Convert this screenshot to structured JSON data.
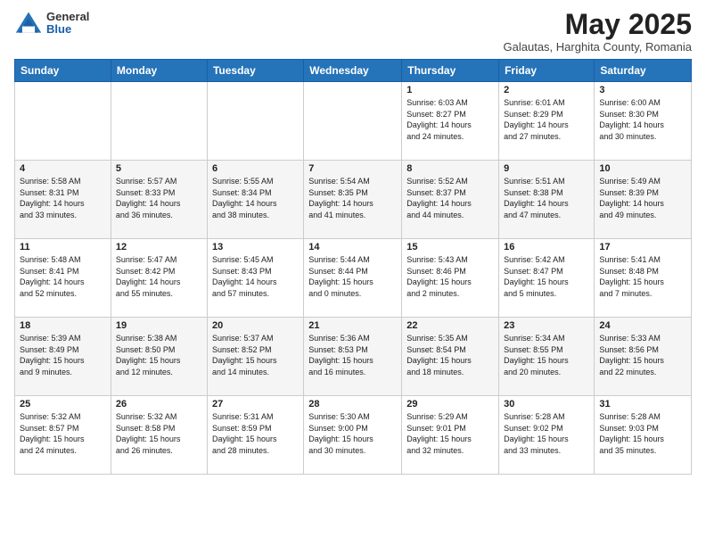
{
  "header": {
    "logo_general": "General",
    "logo_blue": "Blue",
    "month_title": "May 2025",
    "subtitle": "Galautas, Harghita County, Romania"
  },
  "days_of_week": [
    "Sunday",
    "Monday",
    "Tuesday",
    "Wednesday",
    "Thursday",
    "Friday",
    "Saturday"
  ],
  "weeks": [
    [
      {
        "day": "",
        "info": ""
      },
      {
        "day": "",
        "info": ""
      },
      {
        "day": "",
        "info": ""
      },
      {
        "day": "",
        "info": ""
      },
      {
        "day": "1",
        "info": "Sunrise: 6:03 AM\nSunset: 8:27 PM\nDaylight: 14 hours\nand 24 minutes."
      },
      {
        "day": "2",
        "info": "Sunrise: 6:01 AM\nSunset: 8:29 PM\nDaylight: 14 hours\nand 27 minutes."
      },
      {
        "day": "3",
        "info": "Sunrise: 6:00 AM\nSunset: 8:30 PM\nDaylight: 14 hours\nand 30 minutes."
      }
    ],
    [
      {
        "day": "4",
        "info": "Sunrise: 5:58 AM\nSunset: 8:31 PM\nDaylight: 14 hours\nand 33 minutes."
      },
      {
        "day": "5",
        "info": "Sunrise: 5:57 AM\nSunset: 8:33 PM\nDaylight: 14 hours\nand 36 minutes."
      },
      {
        "day": "6",
        "info": "Sunrise: 5:55 AM\nSunset: 8:34 PM\nDaylight: 14 hours\nand 38 minutes."
      },
      {
        "day": "7",
        "info": "Sunrise: 5:54 AM\nSunset: 8:35 PM\nDaylight: 14 hours\nand 41 minutes."
      },
      {
        "day": "8",
        "info": "Sunrise: 5:52 AM\nSunset: 8:37 PM\nDaylight: 14 hours\nand 44 minutes."
      },
      {
        "day": "9",
        "info": "Sunrise: 5:51 AM\nSunset: 8:38 PM\nDaylight: 14 hours\nand 47 minutes."
      },
      {
        "day": "10",
        "info": "Sunrise: 5:49 AM\nSunset: 8:39 PM\nDaylight: 14 hours\nand 49 minutes."
      }
    ],
    [
      {
        "day": "11",
        "info": "Sunrise: 5:48 AM\nSunset: 8:41 PM\nDaylight: 14 hours\nand 52 minutes."
      },
      {
        "day": "12",
        "info": "Sunrise: 5:47 AM\nSunset: 8:42 PM\nDaylight: 14 hours\nand 55 minutes."
      },
      {
        "day": "13",
        "info": "Sunrise: 5:45 AM\nSunset: 8:43 PM\nDaylight: 14 hours\nand 57 minutes."
      },
      {
        "day": "14",
        "info": "Sunrise: 5:44 AM\nSunset: 8:44 PM\nDaylight: 15 hours\nand 0 minutes."
      },
      {
        "day": "15",
        "info": "Sunrise: 5:43 AM\nSunset: 8:46 PM\nDaylight: 15 hours\nand 2 minutes."
      },
      {
        "day": "16",
        "info": "Sunrise: 5:42 AM\nSunset: 8:47 PM\nDaylight: 15 hours\nand 5 minutes."
      },
      {
        "day": "17",
        "info": "Sunrise: 5:41 AM\nSunset: 8:48 PM\nDaylight: 15 hours\nand 7 minutes."
      }
    ],
    [
      {
        "day": "18",
        "info": "Sunrise: 5:39 AM\nSunset: 8:49 PM\nDaylight: 15 hours\nand 9 minutes."
      },
      {
        "day": "19",
        "info": "Sunrise: 5:38 AM\nSunset: 8:50 PM\nDaylight: 15 hours\nand 12 minutes."
      },
      {
        "day": "20",
        "info": "Sunrise: 5:37 AM\nSunset: 8:52 PM\nDaylight: 15 hours\nand 14 minutes."
      },
      {
        "day": "21",
        "info": "Sunrise: 5:36 AM\nSunset: 8:53 PM\nDaylight: 15 hours\nand 16 minutes."
      },
      {
        "day": "22",
        "info": "Sunrise: 5:35 AM\nSunset: 8:54 PM\nDaylight: 15 hours\nand 18 minutes."
      },
      {
        "day": "23",
        "info": "Sunrise: 5:34 AM\nSunset: 8:55 PM\nDaylight: 15 hours\nand 20 minutes."
      },
      {
        "day": "24",
        "info": "Sunrise: 5:33 AM\nSunset: 8:56 PM\nDaylight: 15 hours\nand 22 minutes."
      }
    ],
    [
      {
        "day": "25",
        "info": "Sunrise: 5:32 AM\nSunset: 8:57 PM\nDaylight: 15 hours\nand 24 minutes."
      },
      {
        "day": "26",
        "info": "Sunrise: 5:32 AM\nSunset: 8:58 PM\nDaylight: 15 hours\nand 26 minutes."
      },
      {
        "day": "27",
        "info": "Sunrise: 5:31 AM\nSunset: 8:59 PM\nDaylight: 15 hours\nand 28 minutes."
      },
      {
        "day": "28",
        "info": "Sunrise: 5:30 AM\nSunset: 9:00 PM\nDaylight: 15 hours\nand 30 minutes."
      },
      {
        "day": "29",
        "info": "Sunrise: 5:29 AM\nSunset: 9:01 PM\nDaylight: 15 hours\nand 32 minutes."
      },
      {
        "day": "30",
        "info": "Sunrise: 5:28 AM\nSunset: 9:02 PM\nDaylight: 15 hours\nand 33 minutes."
      },
      {
        "day": "31",
        "info": "Sunrise: 5:28 AM\nSunset: 9:03 PM\nDaylight: 15 hours\nand 35 minutes."
      }
    ]
  ]
}
